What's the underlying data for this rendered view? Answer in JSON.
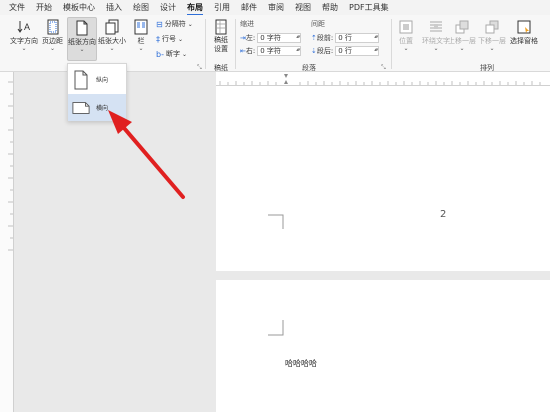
{
  "menu": [
    "文件",
    "开始",
    "模板中心",
    "插入",
    "绘图",
    "设计",
    "布局",
    "引用",
    "邮件",
    "审阅",
    "视图",
    "帮助",
    "PDF工具集"
  ],
  "ribbon": {
    "text_direction": "文字方向",
    "margins": "页边距",
    "orientation": "纸张方向",
    "size": "纸张大小",
    "columns": "栏",
    "breaks": "分隔符",
    "line_numbers": "行号",
    "hyphenation": "断字",
    "draft_paper": "稿纸设置",
    "group_draft": "稿纸",
    "indent_header": "缩进",
    "spacing_header": "间距",
    "left_label": "左:",
    "left_value": "0 字符",
    "right_label": "右:",
    "right_value": "0 字符",
    "before_label": "段前:",
    "before_value": "0 行",
    "after_label": "段后:",
    "after_value": "0 行",
    "group_paragraph": "段落",
    "position": "位置",
    "wrap_text": "环绕文字",
    "bring_forward": "上移一层",
    "send_backward": "下移一层",
    "selection_pane": "选择窗格",
    "group_arrange": "排列"
  },
  "dropdown": {
    "portrait": "纵向",
    "landscape": "横向"
  },
  "document": {
    "page_number": "2",
    "body_text": "哈哈哈哈"
  },
  "colors": {
    "accent": "#2f6fd8",
    "arrow": "#e02020",
    "selected_bg": "#d5e2f3"
  }
}
